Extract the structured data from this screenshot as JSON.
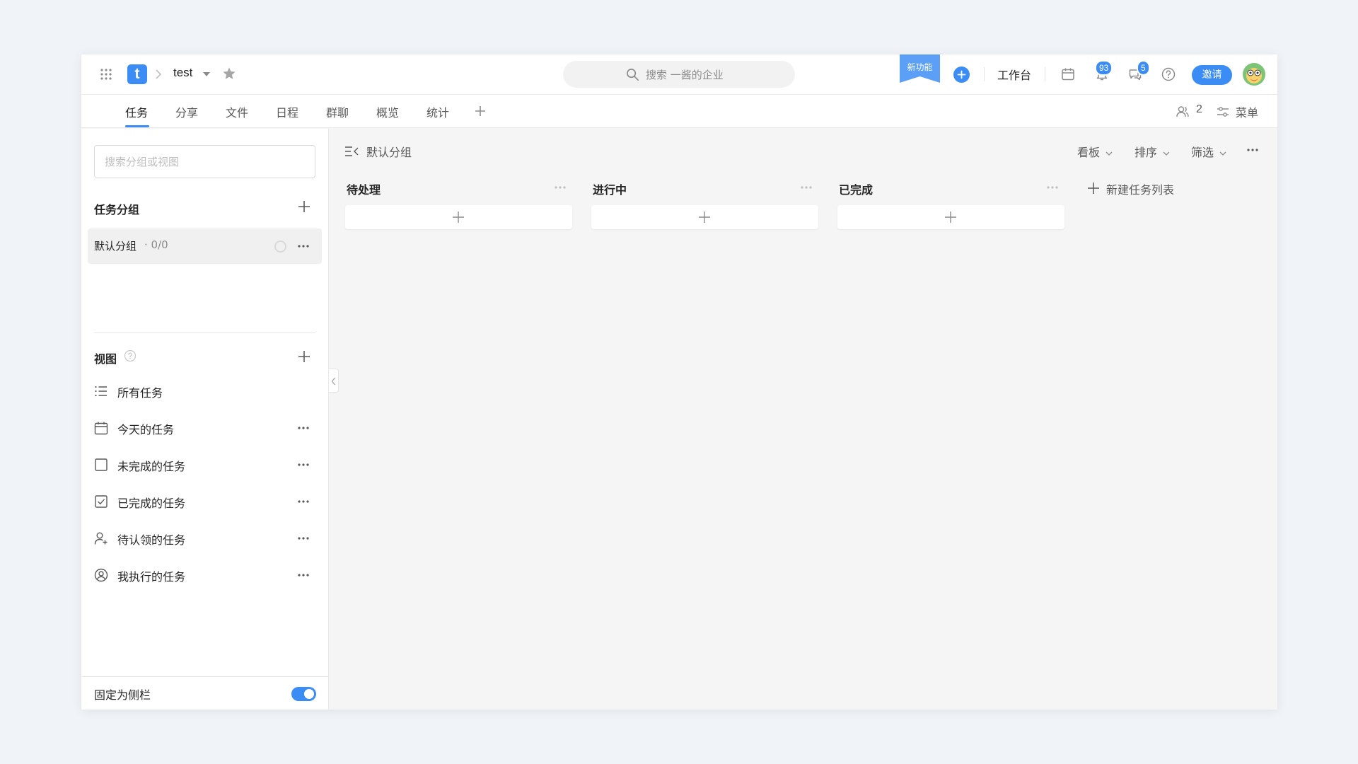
{
  "header": {
    "project_name": "test",
    "search_placeholder": "搜索 一酱的企业",
    "new_feature_label": "新功能",
    "workbench_label": "工作台",
    "notification_badge": "93",
    "message_badge": "5",
    "invite_label": "邀请"
  },
  "tabs": [
    {
      "label": "任务"
    },
    {
      "label": "分享"
    },
    {
      "label": "文件"
    },
    {
      "label": "日程"
    },
    {
      "label": "群聊"
    },
    {
      "label": "概览"
    },
    {
      "label": "统计"
    }
  ],
  "tabbar_right": {
    "members_count": "2",
    "menu_label": "菜单"
  },
  "sidebar": {
    "search_placeholder": "搜索分组或视图",
    "groups_title": "任务分组",
    "group": {
      "name": "默认分组",
      "count": "· 0/0"
    },
    "views_title": "视图",
    "views": [
      {
        "label": "所有任务",
        "icon": "list-icon"
      },
      {
        "label": "今天的任务",
        "icon": "calendar-icon"
      },
      {
        "label": "未完成的任务",
        "icon": "checkbox-empty-icon"
      },
      {
        "label": "已完成的任务",
        "icon": "checkbox-checked-icon"
      },
      {
        "label": "待认领的任务",
        "icon": "user-add-icon"
      },
      {
        "label": "我执行的任务",
        "icon": "user-circle-icon"
      }
    ],
    "pin_label": "固定为侧栏"
  },
  "board": {
    "title": "默认分组",
    "controls": {
      "view": "看板",
      "sort": "排序",
      "filter": "筛选"
    },
    "columns": [
      {
        "title": "待处理"
      },
      {
        "title": "进行中"
      },
      {
        "title": "已完成"
      }
    ],
    "new_list_label": "新建任务列表"
  },
  "colors": {
    "accent": "#3b8cf5",
    "background": "#f5f5f5"
  }
}
